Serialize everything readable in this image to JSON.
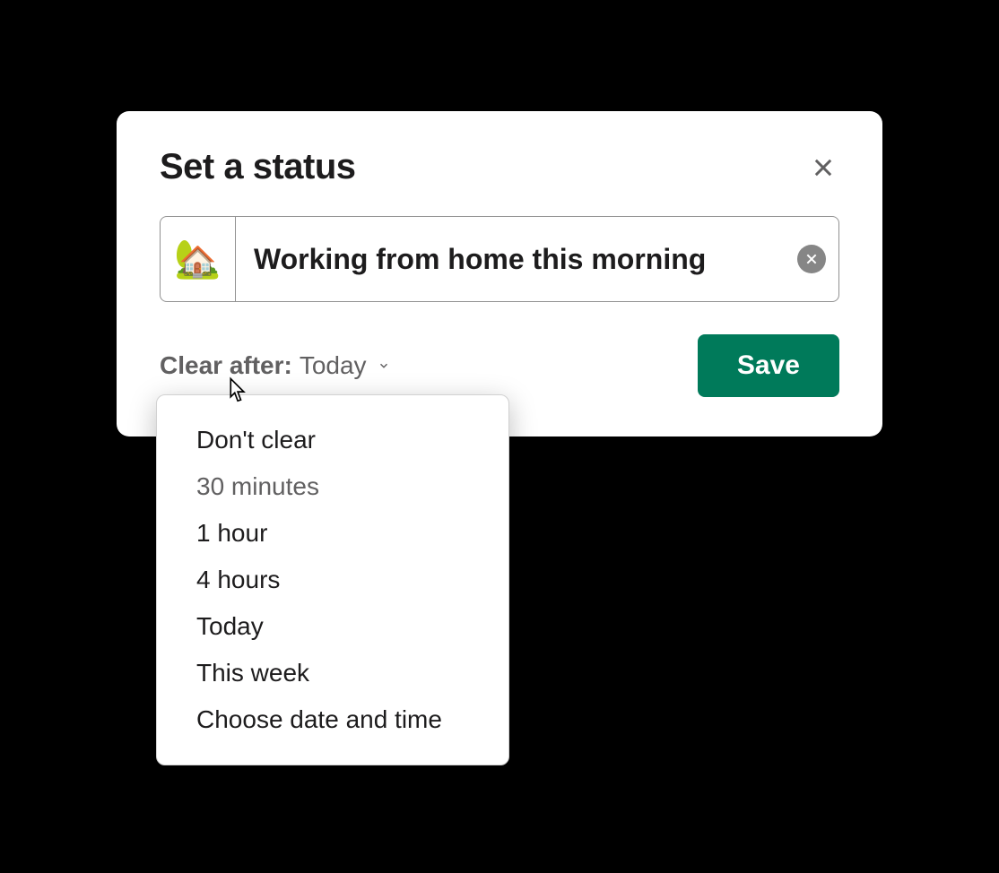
{
  "modal": {
    "title": "Set a status",
    "emoji": "🏡",
    "status_text": "Working from home this morning",
    "clear_after_label": "Clear after:",
    "clear_after_value": "Today",
    "save_label": "Save"
  },
  "dropdown": {
    "items": [
      {
        "label": "Don't clear",
        "muted": false
      },
      {
        "label": "30 minutes",
        "muted": true
      },
      {
        "label": "1 hour",
        "muted": false
      },
      {
        "label": "4 hours",
        "muted": false
      },
      {
        "label": "Today",
        "muted": false
      },
      {
        "label": "This week",
        "muted": false
      },
      {
        "label": "Choose date and time",
        "muted": false
      }
    ]
  }
}
